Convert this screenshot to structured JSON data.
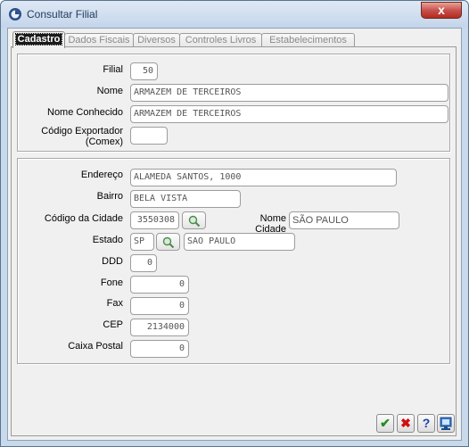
{
  "window": {
    "title": "Consultar Filial",
    "close_glyph": "x"
  },
  "tabs": [
    {
      "label": "Cadastro"
    },
    {
      "label": "Dados Fiscais"
    },
    {
      "label": "Diversos"
    },
    {
      "label": "Controles Livros"
    },
    {
      "label": "Estabelecimentos"
    }
  ],
  "form": {
    "filial": {
      "label": "Filial",
      "value": "50"
    },
    "nome": {
      "label": "Nome",
      "value": "ARMAZEM DE TERCEIROS"
    },
    "nome_conhecido": {
      "label": "Nome Conhecido",
      "value": "ARMAZEM DE TERCEIROS"
    },
    "codigo_exportador": {
      "label_line1": "Código Exportador",
      "label_line2": "(Comex)",
      "value": ""
    },
    "endereco": {
      "label": "Endereço",
      "value": "ALAMEDA SANTOS, 1000"
    },
    "bairro": {
      "label": "Bairro",
      "value": "BELA VISTA"
    },
    "codigo_cidade": {
      "label": "Código da Cidade",
      "value": "3550308"
    },
    "nome_cidade": {
      "label": "Nome Cidade",
      "value": "SÃO PAULO"
    },
    "estado": {
      "label": "Estado",
      "value": "SP",
      "name_value": "SAO PAULO"
    },
    "ddd": {
      "label": "DDD",
      "value": "0"
    },
    "fone": {
      "label": "Fone",
      "value": "0"
    },
    "fax": {
      "label": "Fax",
      "value": "0"
    },
    "cep": {
      "label": "CEP",
      "value": "2134000"
    },
    "caixa_postal": {
      "label": "Caixa Postal",
      "value": "0"
    }
  },
  "buttons": {
    "confirm_glyph": "✔",
    "cancel_glyph": "✖",
    "help_glyph": "?"
  },
  "colors": {
    "confirm": "#1f8f1f",
    "cancel": "#d01010",
    "help": "#1a3fa8",
    "close_button": "#c75050"
  },
  "icons": [
    "app-icon",
    "search-icon",
    "exit-icon"
  ]
}
